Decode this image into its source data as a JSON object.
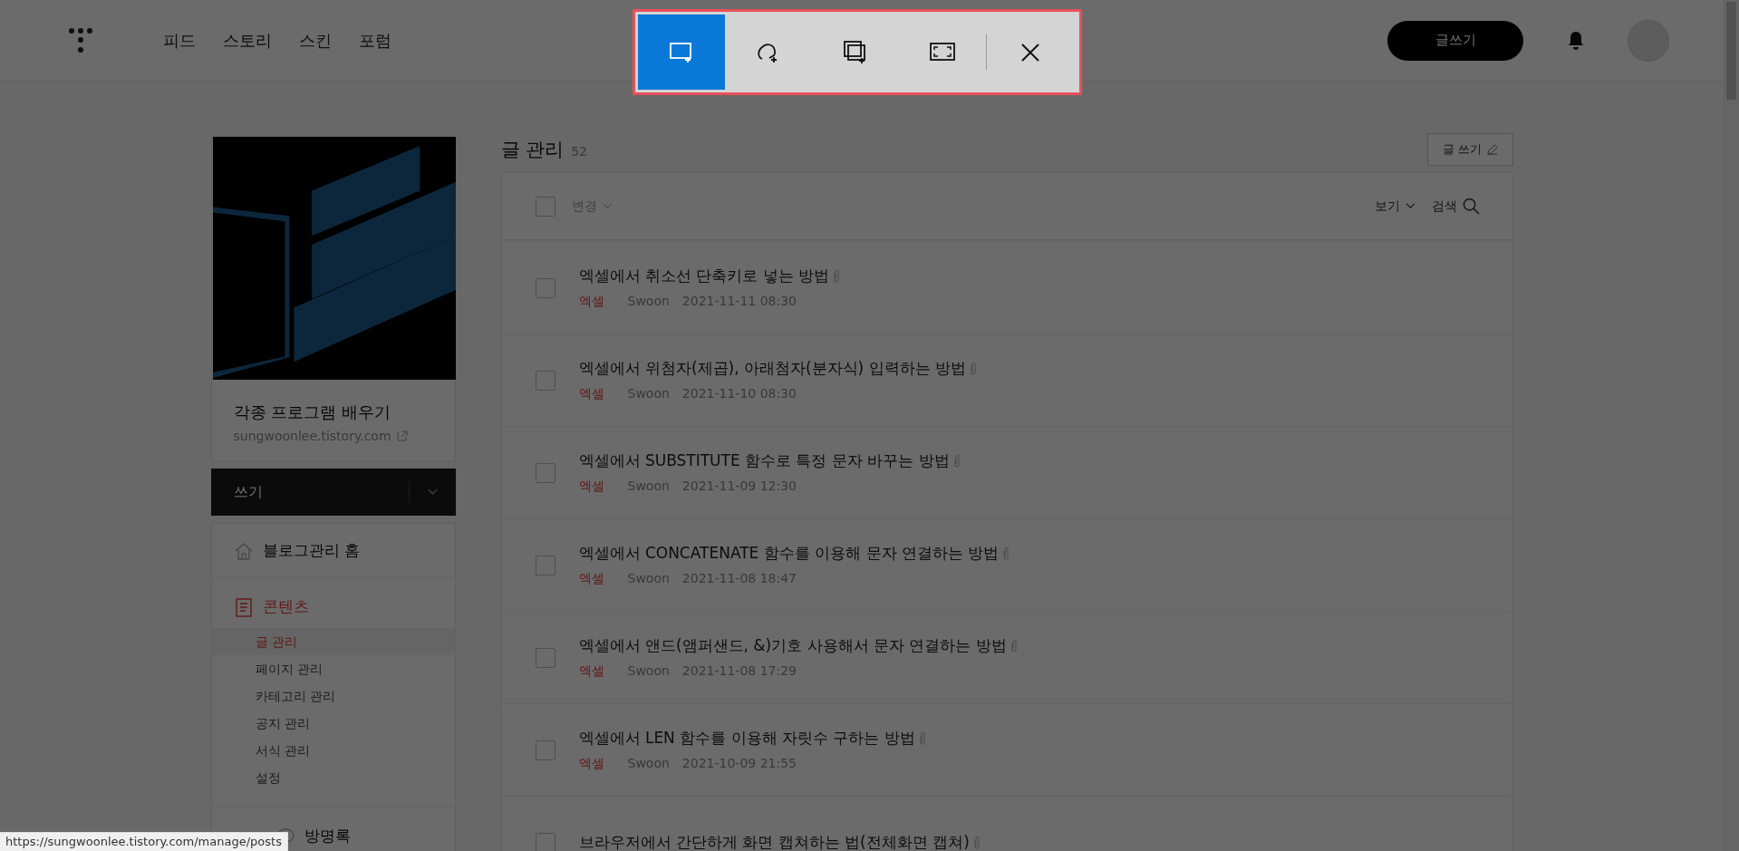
{
  "top_nav": {
    "links": [
      {
        "label": "피드"
      },
      {
        "label": "스토리"
      },
      {
        "label": "스킨"
      },
      {
        "label": "포럼"
      }
    ],
    "write_button": "글쓰기"
  },
  "snip_toolbar": {
    "modes": [
      {
        "kind": "rectangle",
        "selected": true
      },
      {
        "kind": "freeform",
        "selected": false
      },
      {
        "kind": "window",
        "selected": false
      },
      {
        "kind": "fullscreen",
        "selected": false
      }
    ]
  },
  "blog": {
    "title": "각종 프로그램 배우기",
    "url": "sungwoonlee.tistory.com"
  },
  "write_menu": {
    "label": "쓰기"
  },
  "sidebar": {
    "items": [
      {
        "label": "블로그관리 홈",
        "kind": "home",
        "selected": false
      },
      {
        "label": "콘텐츠",
        "kind": "contents",
        "selected": true,
        "children": [
          {
            "label": "글 관리",
            "selected": true
          },
          {
            "label": "페이지 관리",
            "selected": false
          },
          {
            "label": "카테고리 관리",
            "selected": false
          },
          {
            "label": "공지 관리",
            "selected": false
          },
          {
            "label": "서식 관리",
            "selected": false
          },
          {
            "label": "설정",
            "selected": false
          }
        ]
      },
      {
        "label": "방명록",
        "kind": "comments",
        "selected": false
      }
    ]
  },
  "page": {
    "title": "글 관리",
    "count": "52",
    "write_button": "글 쓰기"
  },
  "list_toolbar": {
    "select_all_checked": false,
    "change": "변경",
    "view": "보기",
    "search": "검색"
  },
  "posts": [
    {
      "title": "엑셀에서 취소선 단축키로 넣는 방법",
      "category": "엑셀",
      "author": "Swoon",
      "date": "2021-11-11 08:30",
      "checked": false
    },
    {
      "title": "엑셀에서 위첨자(제곱), 아래첨자(분자식) 입력하는 방법",
      "category": "엑셀",
      "author": "Swoon",
      "date": "2021-11-10 08:30",
      "checked": false
    },
    {
      "title": "엑셀에서 SUBSTITUTE 함수로 특정 문자 바꾸는 방법",
      "category": "엑셀",
      "author": "Swoon",
      "date": "2021-11-09 12:30",
      "checked": false
    },
    {
      "title": "엑셀에서 CONCATENATE 함수를 이용해 문자 연결하는 방법",
      "category": "엑셀",
      "author": "Swoon",
      "date": "2021-11-08 18:47",
      "checked": false
    },
    {
      "title": "엑셀에서 앤드(앰퍼샌드, &)기호 사용해서 문자 연결하는 방법",
      "category": "엑셀",
      "author": "Swoon",
      "date": "2021-11-08 17:29",
      "checked": false
    },
    {
      "title": "엑셀에서 LEN 함수를 이용해 자릿수 구하는 방법",
      "category": "엑셀",
      "author": "Swoon",
      "date": "2021-10-09 21:55",
      "checked": false
    },
    {
      "title": "브라우저에서 간단하게 화면 캡쳐하는 법(전체화면 캡쳐)",
      "checked": false
    }
  ],
  "status_url": "https://sungwoonlee.tistory.com/manage/posts"
}
